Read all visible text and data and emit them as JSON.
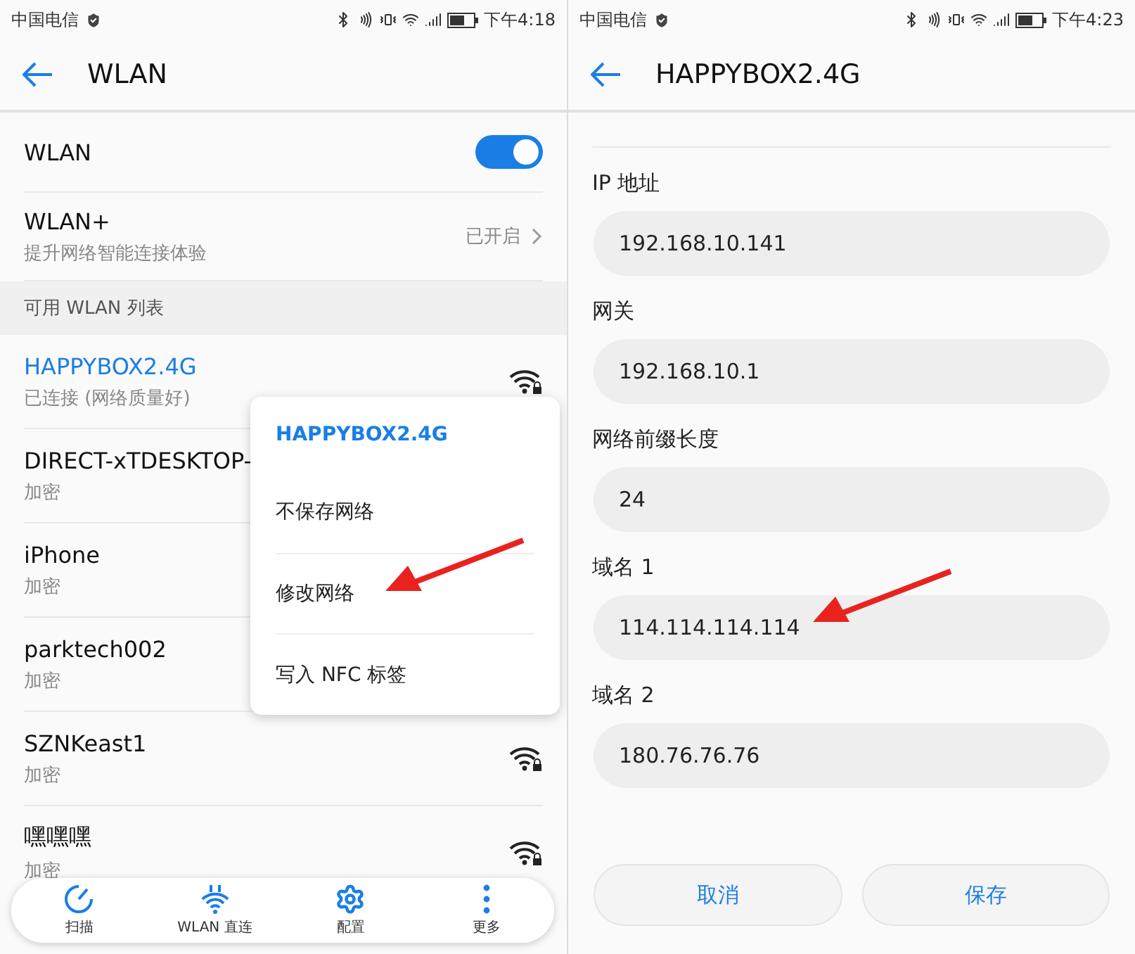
{
  "wlan_screen": {
    "status_bar": {
      "carrier": "中国电信",
      "time": "下午4:18"
    },
    "title": "WLAN",
    "wlan_toggle": {
      "label": "WLAN",
      "on": true
    },
    "wlan_plus": {
      "label": "WLAN+",
      "description": "提升网络智能连接体验",
      "status": "已开启"
    },
    "section_header": "可用 WLAN 列表",
    "networks": [
      {
        "name": "HAPPYBOX2.4G",
        "status": "已连接 (网络质量好)",
        "connected": true
      },
      {
        "name": "DIRECT-xTDESKTOP-",
        "status": "加密",
        "connected": false
      },
      {
        "name": "iPhone",
        "status": "加密",
        "connected": false
      },
      {
        "name": "parktech002",
        "status": "加密",
        "connected": false
      },
      {
        "name": "SZNKeast1",
        "status": "加密",
        "connected": false
      },
      {
        "name": "嘿嘿嘿",
        "status": "加密",
        "connected": false
      }
    ],
    "context_menu": {
      "title": "HAPPYBOX2.4G",
      "items": [
        "不保存网络",
        "修改网络",
        "写入 NFC 标签"
      ]
    },
    "toolbar": [
      {
        "kind": "scan",
        "label": "扫描"
      },
      {
        "kind": "direct",
        "label": "WLAN 直连"
      },
      {
        "kind": "config",
        "label": "配置"
      },
      {
        "kind": "more",
        "label": "更多"
      }
    ]
  },
  "network_screen": {
    "status_bar": {
      "carrier": "中国电信",
      "time": "下午4:23"
    },
    "title": "HAPPYBOX2.4G",
    "fields": [
      {
        "label": "IP 地址",
        "value": "192.168.10.141"
      },
      {
        "label": "网关",
        "value": "192.168.10.1"
      },
      {
        "label": "网络前缀长度",
        "value": "24"
      },
      {
        "label": "域名 1",
        "value": "114.114.114.114"
      },
      {
        "label": "域名 2",
        "value": "180.76.76.76"
      }
    ],
    "buttons": [
      "取消",
      "保存"
    ]
  }
}
